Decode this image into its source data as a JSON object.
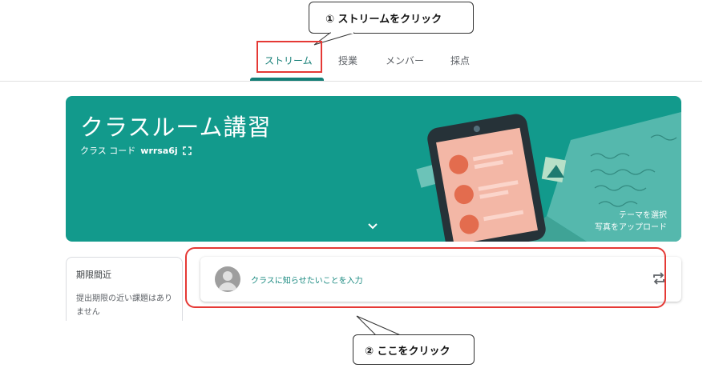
{
  "callouts": {
    "step1": "① ストリームをクリック",
    "step2": "② ここをクリック"
  },
  "tabs": [
    {
      "label": "ストリーム",
      "active": true
    },
    {
      "label": "授業",
      "active": false
    },
    {
      "label": "メンバー",
      "active": false
    },
    {
      "label": "採点",
      "active": false
    }
  ],
  "banner": {
    "title": "クラスルーム講習",
    "code_label": "クラス コード",
    "code_value": "wrrsa6j",
    "select_theme": "テーマを選択",
    "upload_photo": "写真をアップロード",
    "background_color": "#129a8c"
  },
  "upcoming": {
    "title": "期限間近",
    "empty_text": "提出期限の近い課題はありません"
  },
  "announce": {
    "placeholder": "クラスに知らせたいことを入力"
  },
  "colors": {
    "accent": "#137e76",
    "highlight": "#e53935"
  }
}
